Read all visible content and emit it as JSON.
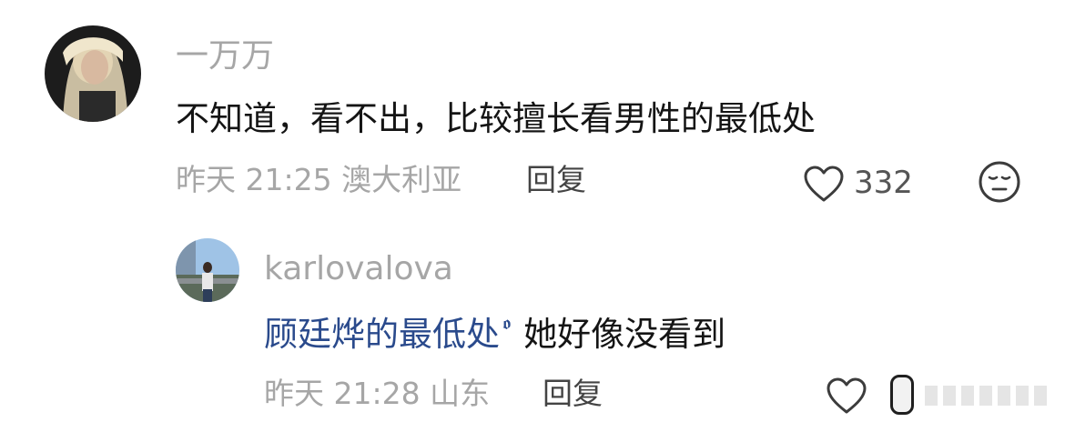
{
  "comments": [
    {
      "username": "一万万",
      "text": "不知道，看不出，比较擅长看男性的最低处",
      "meta": "昨天 21:25 澳大利亚",
      "reply_label": "回复",
      "like_count": "332",
      "avatar_icon": "user-avatar",
      "like_icon": "heart-outline-icon",
      "emoji_icon": "expressionless-face-icon"
    },
    {
      "username": "karlovalova",
      "mention": "顾廷烨的最低处",
      "mention_icon": "search-icon",
      "text": "她好像没看到",
      "meta": "昨天 21:28 山东",
      "reply_label": "回复",
      "avatar_icon": "user-avatar",
      "like_icon": "heart-outline-icon"
    }
  ],
  "colors": {
    "muted_text": "#a6a6a6",
    "body_text": "#141414",
    "mention": "#2a4a8c",
    "reply": "#444444"
  }
}
